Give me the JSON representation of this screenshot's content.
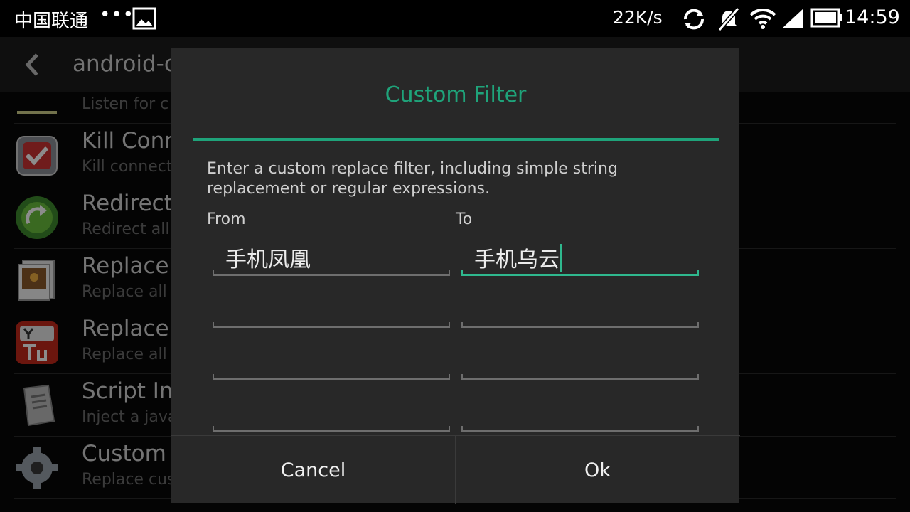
{
  "status_bar": {
    "carrier": "中国联通",
    "more": "•••",
    "net_speed": "22K/s",
    "time": "14:59",
    "icons": [
      "gallery-icon",
      "sync-icon",
      "mute-icon",
      "wifi-icon",
      "signal-icon",
      "battery-icon"
    ]
  },
  "app_bar": {
    "title": "android-c"
  },
  "list": {
    "items": [
      {
        "title": "",
        "subtitle": "Listen for c",
        "icon": "plugin-icon"
      },
      {
        "title": "Kill Conn",
        "subtitle": "Kill connect",
        "icon": "kill-connections-icon"
      },
      {
        "title": "Redirect",
        "subtitle": "Redirect all",
        "icon": "redirect-icon"
      },
      {
        "title": "Replace",
        "subtitle": "Replace all",
        "icon": "replace-images-icon"
      },
      {
        "title": "Replace Y",
        "subtitle": "Replace all Y",
        "icon": "youtube-icon"
      },
      {
        "title": "Script Inj",
        "subtitle": "Inject a java",
        "icon": "script-injection-icon"
      },
      {
        "title": "Custom F",
        "subtitle": "Replace cus",
        "icon": "gear-icon"
      }
    ]
  },
  "dialog": {
    "title": "Custom Filter",
    "description": "Enter a custom replace filter, including simple string replacement or regular expressions.",
    "from_label": "From",
    "to_label": "To",
    "rows": [
      {
        "from": "手机凤凰",
        "to": "手机乌云"
      },
      {
        "from": "",
        "to": ""
      },
      {
        "from": "",
        "to": ""
      },
      {
        "from": "",
        "to": ""
      }
    ],
    "cancel_label": "Cancel",
    "ok_label": "Ok"
  },
  "colors": {
    "accent": "#1fa37a",
    "dialog_bg": "#282828"
  }
}
